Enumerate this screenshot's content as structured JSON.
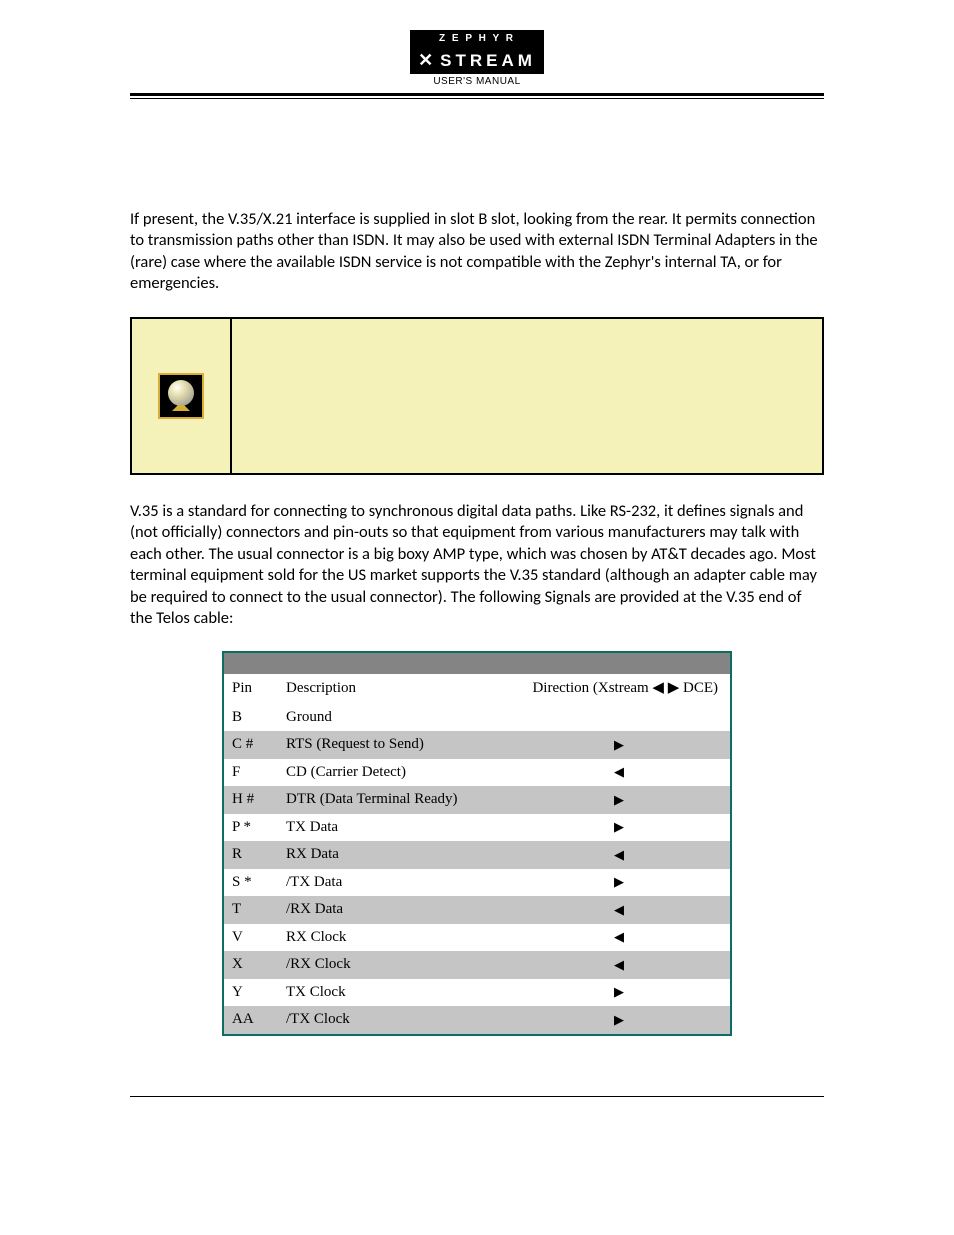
{
  "logo": {
    "top_letters": "Z E P H Y R",
    "bottom_word": "STREAM",
    "subtitle": "USER'S MANUAL"
  },
  "paragraph1": "If present, the V.35/X.21 interface is supplied in slot B slot, looking from the rear. It permits connection to transmission paths other than ISDN.  It may also be used with external ISDN Terminal Adapters in the (rare) case where the available ISDN service is not compatible with the Zephyr's internal TA, or for emergencies.",
  "paragraph2": "V.35 is a standard for connecting to synchronous digital data paths.  Like RS-232, it defines signals and (not officially) connectors and pin-outs so that equipment from various manufacturers may talk with each other.  The usual connector is a big boxy AMP type, which was chosen by AT&T decades ago.  Most terminal equipment sold for the US market supports the V.35 standard (although an adapter cable may be required to connect to the usual connector).  The following Signals are provided at the V.35 end of the Telos cable:",
  "table": {
    "header_pin": "Pin",
    "header_desc": "Description",
    "header_dir": "Direction (Xstream ◀ ▶ DCE)",
    "rows": [
      {
        "pin": "B",
        "desc": "Ground",
        "dir": ""
      },
      {
        "pin": "C #",
        "desc": "RTS (Request to Send)",
        "dir": "▶"
      },
      {
        "pin": "F",
        "desc": "CD (Carrier Detect)",
        "dir": "◀"
      },
      {
        "pin": "H #",
        "desc": "DTR (Data Terminal Ready)",
        "dir": "▶"
      },
      {
        "pin": "P *",
        "desc": "TX Data",
        "dir": "▶"
      },
      {
        "pin": "R",
        "desc": "RX Data",
        "dir": "◀"
      },
      {
        "pin": "S *",
        "desc": "/TX Data",
        "dir": "▶"
      },
      {
        "pin": "T",
        "desc": "/RX Data",
        "dir": "◀"
      },
      {
        "pin": "V",
        "desc": "RX Clock",
        "dir": "◀"
      },
      {
        "pin": "X",
        "desc": "/RX Clock",
        "dir": "◀"
      },
      {
        "pin": "Y",
        "desc": "TX Clock",
        "dir": "▶"
      },
      {
        "pin": "AA",
        "desc": "/TX Clock",
        "dir": "▶"
      }
    ]
  }
}
